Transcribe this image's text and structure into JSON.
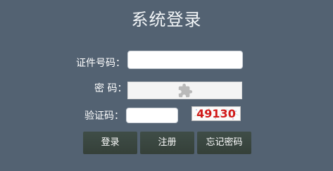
{
  "page": {
    "title": "系统登录"
  },
  "form": {
    "id_label": "证件号码：",
    "id_value": "",
    "password_label": "密 码：",
    "password_icon": "puzzle-icon",
    "captcha_label": "验证码：",
    "captcha_value": "",
    "captcha_image_text": "49130"
  },
  "buttons": {
    "login": "登录",
    "register": "注册",
    "forgot": "忘记密码"
  },
  "colors": {
    "background": "#536272",
    "button": "#3c4943",
    "captcha_text": "#d11a1a"
  }
}
